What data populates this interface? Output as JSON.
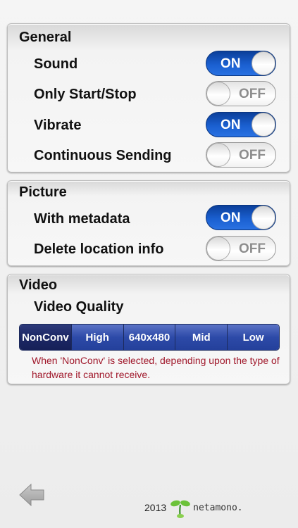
{
  "general": {
    "title": "General",
    "rows": [
      {
        "label": "Sound",
        "state": "ON"
      },
      {
        "label": "Only Start/Stop",
        "state": "OFF"
      },
      {
        "label": "Vibrate",
        "state": "ON"
      },
      {
        "label": "Continuous Sending",
        "state": "OFF"
      }
    ]
  },
  "picture": {
    "title": "Picture",
    "rows": [
      {
        "label": "With metadata",
        "state": "ON"
      },
      {
        "label": "Delete location info",
        "state": "OFF"
      }
    ]
  },
  "video": {
    "title": "Video",
    "quality_label": "Video Quality",
    "options": [
      "NonConv",
      "High",
      "640x480",
      "Mid",
      "Low"
    ],
    "selected": "NonConv",
    "note": "When 'NonConv' is selected, depending upon the type of hardware it cannot receive."
  },
  "footer": {
    "year": "2013",
    "brand": "netamono."
  },
  "colors": {
    "toggle_on": "#1a5fd0",
    "segment": "#2d4aa8",
    "segment_selected": "#1c2865",
    "note_text": "#a0182b"
  },
  "icons": {
    "back": "left-arrow-icon",
    "logo": "sprout-icon"
  }
}
